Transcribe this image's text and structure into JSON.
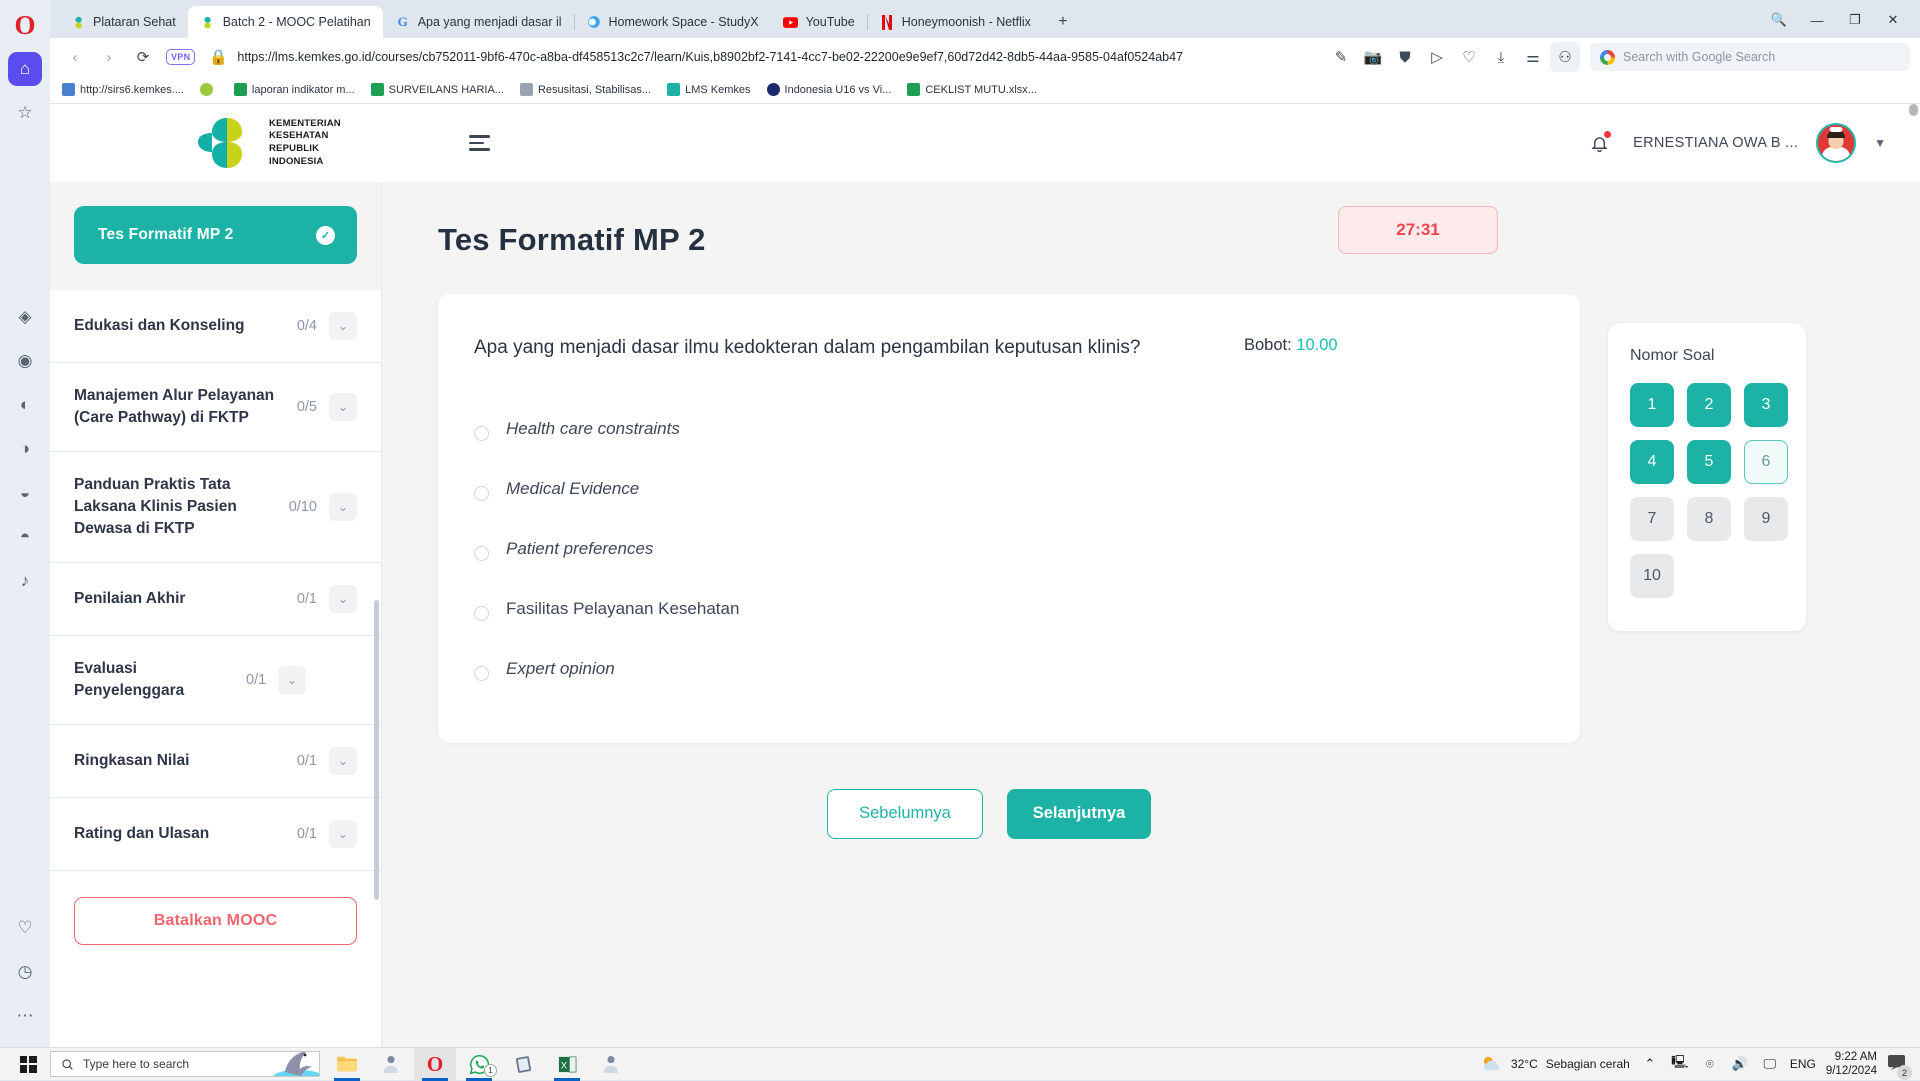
{
  "browser": {
    "name": "Opera",
    "tabs": [
      {
        "label": "Plataran Sehat",
        "favicon": "kemkes-icon",
        "active": false
      },
      {
        "label": "Batch 2 - MOOC Pelatihan",
        "favicon": "kemkes-icon",
        "active": true
      },
      {
        "label": "Apa yang menjadi dasar il",
        "favicon": "google-icon",
        "active": false
      },
      {
        "label": "Homework Space - StudyX",
        "favicon": "studyx-icon",
        "active": false
      },
      {
        "label": "YouTube",
        "favicon": "youtube-icon",
        "active": false
      },
      {
        "label": "Honeymoonish - Netflix",
        "favicon": "netflix-icon",
        "active": false
      }
    ],
    "new_tab_label": "+",
    "url": "https://lms.kemkes.go.id/courses/cb752011-9bf6-470c-a8ba-df458513c2c7/learn/Kuis,b8902bf2-7141-4cc7-be02-22200e9e9ef7,60d72d42-8db5-44aa-9585-04af0524ab47",
    "vpn_label": "VPN",
    "search_placeholder": "Search with Google Search",
    "bookmarks": [
      {
        "label": "http://sirs6.kemkes....",
        "color": "#4a7fd0"
      },
      {
        "label": "",
        "color": "#9fc93c"
      },
      {
        "label": "laporan indikator m...",
        "color": "#1e9e52"
      },
      {
        "label": "SURVEILANS HARIA...",
        "color": "#1e9e52"
      },
      {
        "label": "Resusitasi, Stabilisas...",
        "color": "#9aa4b0"
      },
      {
        "label": "LMS Kemkes",
        "color": "#1cb3a6"
      },
      {
        "label": "Indonesia U16 vs Vi...",
        "color": "#1a2a6c"
      },
      {
        "label": "CEKLIST MUTU.xlsx...",
        "color": "#1e9e52"
      }
    ],
    "toolbar_icons": [
      "back-icon",
      "forward-icon",
      "reload-icon",
      "lock-icon",
      "edit-icon",
      "camera-icon",
      "shield-icon",
      "send-icon",
      "heart-icon",
      "download-icon",
      "settings-sliders-icon",
      "profile-icon"
    ],
    "window_controls": [
      "minimize",
      "maximize",
      "close"
    ]
  },
  "site_header": {
    "logo_lines": [
      "KEMENTERIAN",
      "KESEHATAN",
      "REPUBLIK",
      "INDONESIA"
    ],
    "username": "ERNESTIANA OWA B ...",
    "notification_has_badge": true
  },
  "sidebar": {
    "active_lesson": {
      "label": "Tes Formatif MP 2",
      "status": "completed"
    },
    "sections": [
      {
        "label": "Edukasi dan Konseling",
        "count": "0/4"
      },
      {
        "label": "Manajemen Alur Pelayanan (Care Pathway) di FKTP",
        "count": "0/5"
      },
      {
        "label": "Panduan Praktis Tata Laksana Klinis Pasien Dewasa di FKTP",
        "count": "0/10"
      },
      {
        "label": "Penilaian Akhir",
        "count": "0/1"
      },
      {
        "label": "Evaluasi Penyelenggara",
        "count": "0/1"
      },
      {
        "label": "Ringkasan Nilai",
        "count": "0/1"
      },
      {
        "label": "Rating dan Ulasan",
        "count": "0/1"
      }
    ],
    "cancel_label": "Batalkan MOOC"
  },
  "quiz": {
    "title": "Tes Formatif MP 2",
    "timer": "27:31",
    "question": "Apa yang menjadi dasar ilmu kedokteran dalam pengambilan keputusan klinis?",
    "bobot_label": "Bobot:",
    "bobot_value": "10.00",
    "options": [
      {
        "label": "Health care constraints",
        "selected": false,
        "italic": true
      },
      {
        "label": "Medical Evidence",
        "selected": false,
        "italic": true
      },
      {
        "label": "Patient preferences",
        "selected": false,
        "italic": true
      },
      {
        "label": "Fasilitas Pelayanan Kesehatan",
        "selected": false,
        "italic": false
      },
      {
        "label": "Expert opinion",
        "selected": false,
        "italic": true
      }
    ],
    "prev_label": "Sebelumnya",
    "next_label": "Selanjutnya"
  },
  "number_panel": {
    "title": "Nomor Soal",
    "items": [
      {
        "n": "1",
        "state": "done"
      },
      {
        "n": "2",
        "state": "done"
      },
      {
        "n": "3",
        "state": "done"
      },
      {
        "n": "4",
        "state": "done"
      },
      {
        "n": "5",
        "state": "done"
      },
      {
        "n": "6",
        "state": "current"
      },
      {
        "n": "7",
        "state": "todo"
      },
      {
        "n": "8",
        "state": "todo"
      },
      {
        "n": "9",
        "state": "todo"
      },
      {
        "n": "10",
        "state": "todo"
      }
    ]
  },
  "taskbar": {
    "search_placeholder": "Type here to search",
    "apps": [
      "file-explorer-icon",
      "person-icon",
      "opera-icon",
      "whatsapp-icon",
      "notebook-icon",
      "excel-icon",
      "person2-icon"
    ],
    "whatsapp_badge": "1",
    "weather_temp": "32°C",
    "weather_desc": "Sebagian cerah",
    "language": "ENG",
    "time": "9:22 AM",
    "date": "9/12/2024",
    "notification_count": "2"
  },
  "colors": {
    "teal": "#1cb3a6",
    "red": "#f0474e",
    "text_dark": "#2c3544",
    "muted": "#8e98a5"
  }
}
